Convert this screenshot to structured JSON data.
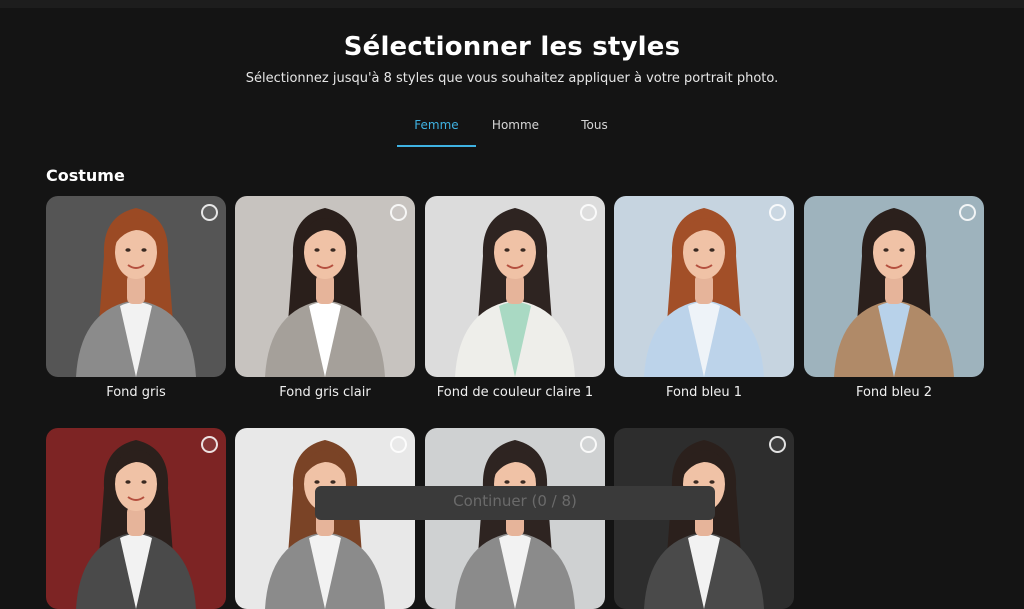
{
  "header": {
    "title": "Sélectionner les styles",
    "subtitle": "Sélectionnez jusqu'à 8 styles que vous souhaitez appliquer à votre portrait photo."
  },
  "tabs": [
    {
      "label": "Femme",
      "active": true
    },
    {
      "label": "Homme",
      "active": false
    },
    {
      "label": "Tous",
      "active": false
    }
  ],
  "section": {
    "title": "Costume"
  },
  "styles": [
    {
      "label": "Fond gris",
      "bg": "#555555",
      "hair": "#9b4a24",
      "suit": "#8b8b8b",
      "shirt": "#f2f2f2",
      "selected": false
    },
    {
      "label": "Fond gris clair",
      "bg": "#c7c3bf",
      "hair": "#2a1f1b",
      "suit": "#a5a09a",
      "shirt": "#ffffff",
      "selected": false
    },
    {
      "label": "Fond de couleur claire 1",
      "bg": "#dcdcdc",
      "hair": "#2e2421",
      "suit": "#eeeeea",
      "shirt": "#a9d9c3",
      "selected": false
    },
    {
      "label": "Fond bleu 1",
      "bg": "#c6d4e0",
      "hair": "#a24f28",
      "suit": "#bcd3ea",
      "shirt": "#eef3f8",
      "selected": false
    },
    {
      "label": "Fond bleu 2",
      "bg": "#9eb3bd",
      "hair": "#2b201c",
      "suit": "#b08a68",
      "shirt": "#b8d2ea",
      "selected": false
    }
  ],
  "styles_row2": [
    {
      "bg": "#7d2424",
      "hair": "#2b201c",
      "suit": "#4a4a4a",
      "shirt": "#f2f2f2",
      "selected": false
    },
    {
      "bg": "#e8e8e8",
      "hair": "#7a4326",
      "suit": "#8b8b8b",
      "shirt": "#f2f2f2",
      "selected": false
    },
    {
      "bg": "#cfd1d2",
      "hair": "#2e2421",
      "suit": "#8b8b8b",
      "shirt": "#f2f2f2",
      "selected": false
    },
    {
      "bg": "#2d2d2d",
      "hair": "#2b201c",
      "suit": "#4a4a4a",
      "shirt": "#f2f2f2",
      "selected": false
    }
  ],
  "footer": {
    "continue_label": "Continuer (0 / 8)"
  },
  "colors": {
    "accent": "#3fb2e2",
    "background": "#141414"
  }
}
